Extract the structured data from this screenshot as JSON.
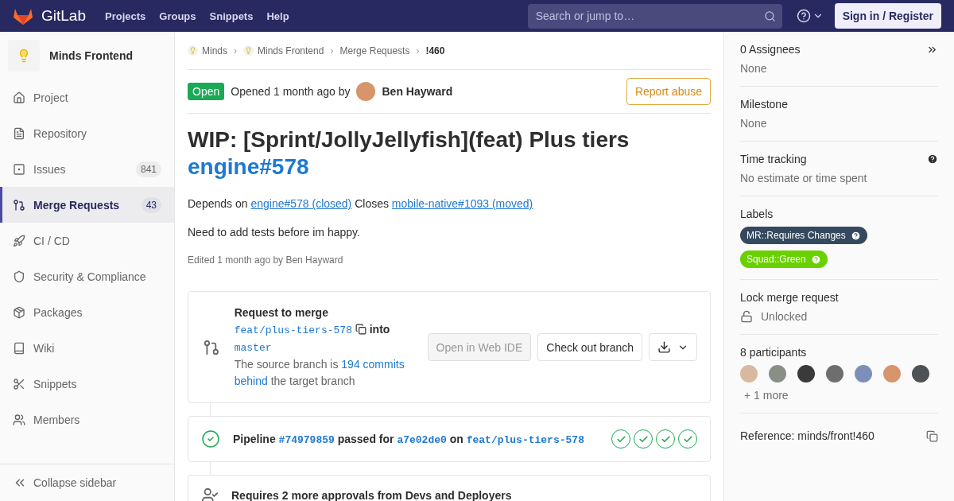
{
  "navbar": {
    "brand": "GitLab",
    "links": [
      "Projects",
      "Groups",
      "Snippets",
      "Help"
    ],
    "search": {
      "placeholder": "Search or jump to…"
    },
    "sign_in": "Sign in / Register"
  },
  "sidebar": {
    "project": "Minds Frontend",
    "items": [
      {
        "label": "Project",
        "selected": false
      },
      {
        "label": "Repository",
        "selected": false
      },
      {
        "label": "Issues",
        "count": "841",
        "selected": false
      },
      {
        "label": "Merge Requests",
        "count": "43",
        "selected": true
      },
      {
        "label": "CI / CD",
        "selected": false
      },
      {
        "label": "Security & Compliance",
        "selected": false
      },
      {
        "label": "Packages",
        "selected": false
      },
      {
        "label": "Wiki",
        "selected": false
      },
      {
        "label": "Snippets",
        "selected": false
      },
      {
        "label": "Members",
        "selected": false
      }
    ],
    "collapse": "Collapse sidebar"
  },
  "breadcrumbs": [
    {
      "label": "Minds",
      "avatar": true
    },
    {
      "separator": "›",
      "label": "Minds Frontend",
      "avatar": true
    },
    {
      "separator": "›",
      "label": "Merge Requests",
      "avatar": false
    },
    {
      "separator": "›",
      "label": "!460",
      "avatar": false
    }
  ],
  "header": {
    "status": "Open",
    "opened": "Opened 1 month ago by",
    "author": "Ben Hayward",
    "report": "Report abuse"
  },
  "title": [
    {
      "kind": "text",
      "text": "WIP: [Sprint/JollyJellyfish](feat) Plus tiers"
    },
    {
      "kind": "link",
      "text": "engine#578"
    }
  ],
  "description": [
    [
      {
        "kind": "text",
        "text": "Depends on "
      },
      {
        "kind": "link",
        "text": "engine#578 (closed)"
      },
      {
        "kind": "text",
        "text": " Closes "
      },
      {
        "kind": "link",
        "text": "mobile-native#1093 (moved)"
      }
    ],
    [
      {
        "kind": "text",
        "text": "Need to add tests before im happy."
      }
    ]
  ],
  "edited": "Edited 1 month ago by Ben Hayward",
  "merge": {
    "heading": "Request to merge",
    "source": "feat/plus-tiers-578",
    "into": "into",
    "target": "master",
    "behind_pre": "The source branch is ",
    "behind_link": "194 commits behind",
    "behind_post": " the target branch",
    "web_ide": "Open in Web IDE",
    "web_ide_disabled": true,
    "checkout": "Check out branch"
  },
  "pipeline": {
    "label": "Pipeline",
    "id": "#74979859",
    "passed_for": "passed for",
    "commit": "a7e02de0",
    "on": "on",
    "branch": "feat/plus-tiers-578",
    "stages": [
      {
        "passed": true
      },
      {
        "passed": true
      },
      {
        "passed": true
      },
      {
        "passed": true
      }
    ]
  },
  "approvals": {
    "text": "Requires 2 more approvals from Devs and Deployers"
  },
  "right": {
    "assignees": {
      "title": "0 Assignees",
      "value": "None"
    },
    "milestone": {
      "title": "Milestone",
      "value": "None"
    },
    "time": {
      "title": "Time tracking",
      "value": "No estimate or time spent"
    },
    "labels": {
      "title": "Labels",
      "items": [
        {
          "text": "MR::Requires Changes",
          "color": "#34495e"
        },
        {
          "text": "Squad::Green",
          "color": "#69d100"
        }
      ]
    },
    "lock": {
      "title": "Lock merge request",
      "value": "Unlocked",
      "locked": false
    },
    "participants": {
      "title": "8 participants",
      "avatars": [
        {
          "kind": "photo"
        },
        {
          "kind": "photo"
        },
        {
          "kind": "photo"
        },
        {
          "kind": "photo"
        },
        {
          "kind": "photo"
        },
        {
          "kind": "photo"
        },
        {
          "kind": "photo"
        }
      ],
      "more": "+ 1 more"
    },
    "reference": "Reference: minds/front!460"
  }
}
